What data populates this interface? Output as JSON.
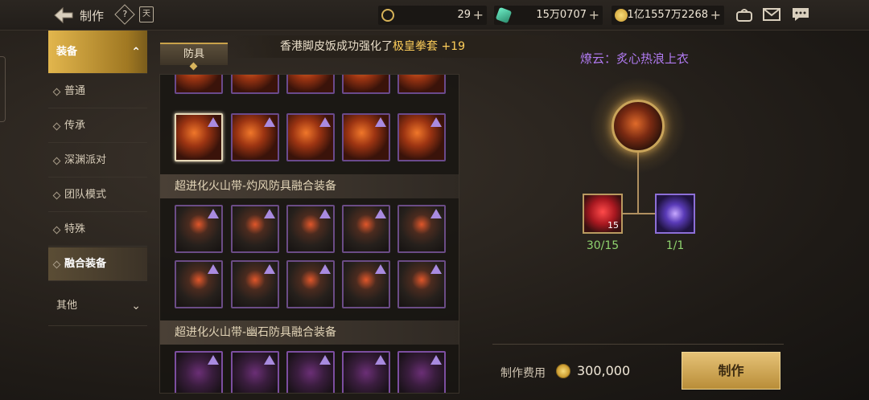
{
  "header": {
    "title": "制作",
    "help_label": "?",
    "calendar_label": "天",
    "currencies": [
      {
        "icon": "clock-coin-icon",
        "value": "29"
      },
      {
        "icon": "crystal-icon",
        "value": "15万0707"
      },
      {
        "icon": "gold-coin-icon",
        "value": "1亿1557万2268"
      }
    ]
  },
  "sidebar": {
    "items": [
      {
        "label": "装备"
      },
      {
        "label": "普通"
      },
      {
        "label": "传承"
      },
      {
        "label": "深渊派对"
      },
      {
        "label": "团队模式"
      },
      {
        "label": "特殊"
      },
      {
        "label": "融合装备"
      },
      {
        "label": "其他"
      }
    ],
    "expand_chevron": "⌃",
    "collapse_chevron": "⌄"
  },
  "tab": {
    "label": "防具"
  },
  "notice": {
    "prefix": "香港脚皮饭成功强化了",
    "item": "极皇拳套",
    "suffix": " +19"
  },
  "list": {
    "sections": [
      {
        "title": "超进化火山带-灼风防具融合装备"
      },
      {
        "title": "超进化火山带-幽石防具融合装备"
      }
    ]
  },
  "detail": {
    "name": "燎云：炙心热浪上衣",
    "materials": [
      {
        "count": "15",
        "progress": "30/15"
      },
      {
        "count": "",
        "progress": "1/1"
      }
    ]
  },
  "footer": {
    "cost_label": "制作费用",
    "cost_value": "300,000",
    "make_label": "制作"
  },
  "colors": {
    "accent": "#c9a24a",
    "rare": "#b07af0",
    "ok": "#8fd36e",
    "notice_highlight": "#ffcf5a"
  }
}
